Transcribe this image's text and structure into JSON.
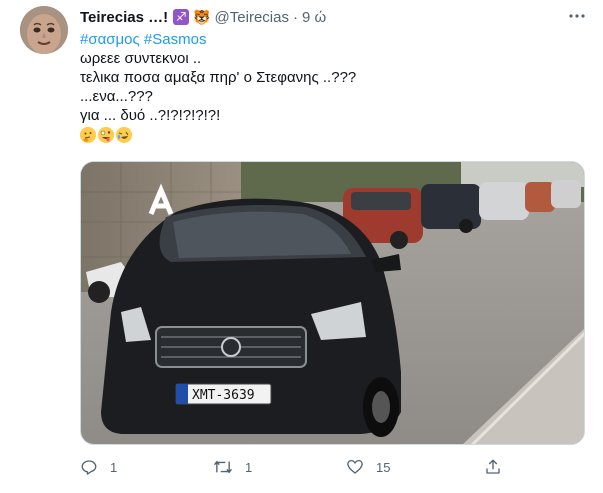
{
  "tweet": {
    "display_name": "Teirecias …!",
    "badge_icon": "sagittarius-icon",
    "extra_icon": "tiger-emoji",
    "handle": "@Teirecias",
    "separator": "·",
    "time": "9 ώ",
    "hashtags": [
      "#σασμος",
      "#Sasmos"
    ],
    "lines": [
      "ωρεεε συντεκνοι ..",
      "τελικα ποσα αμαξα πηρ' ο Στεφανης ..???",
      "...ενα...???",
      "για ... δυό ..?!?!?!?!?!"
    ],
    "emojis": [
      "thinking-face-emoji",
      "zany-face-emoji",
      "rolling-laughing-emoji"
    ],
    "media": {
      "channel_logo": "alpha-logo",
      "license_plate": "XMT-3639"
    },
    "actions": {
      "reply_count": "1",
      "retweet_count": "1",
      "like_count": "15"
    }
  }
}
